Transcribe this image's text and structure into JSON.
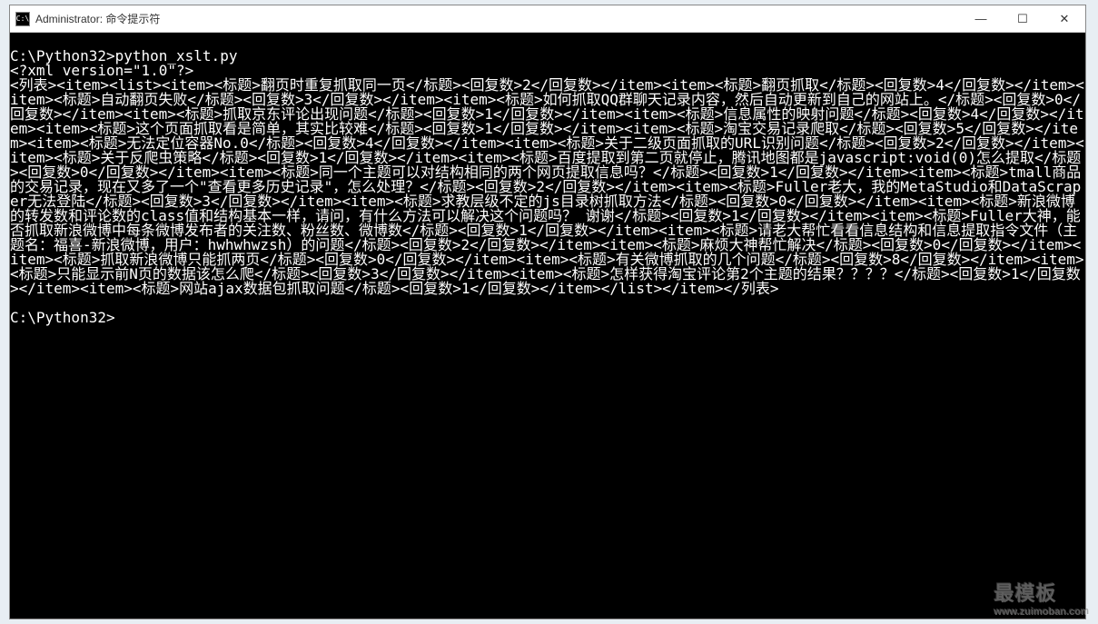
{
  "titlebar": {
    "icon_label": "C:\\",
    "title": "Administrator: 命令提示符",
    "minimize": "—",
    "maximize": "☐",
    "close": "✕"
  },
  "console": {
    "blank": "",
    "prompt_cmd": "C:\\Python32>python_xslt.py",
    "xml_decl": "<?xml version=\"1.0\"?>",
    "prompt_end": "C:\\Python32>"
  },
  "xml_root": "列表",
  "items": [
    {
      "title": "翻页时重复抓取同一页",
      "reply": "2"
    },
    {
      "title": "翻页抓取",
      "reply": "4"
    },
    {
      "title": "自动翻页失败",
      "reply": "3"
    },
    {
      "title": "如何抓取QQ群聊天记录内容，然后自动更新到自己的网站上。",
      "reply": "0"
    },
    {
      "title": "抓取京东评论出现问题",
      "reply": "1"
    },
    {
      "title": "信息属性的映射问题",
      "reply": "4"
    },
    {
      "title": "这个页面抓取看是简单，其实比较难",
      "reply": "1"
    },
    {
      "title": "淘宝交易记录爬取",
      "reply": "5"
    },
    {
      "title": "无法定位容器No.0",
      "reply": "4"
    },
    {
      "title": "关于二级页面抓取的URL识别问题",
      "reply": "2"
    },
    {
      "title": "关于反爬虫策略",
      "reply": "1"
    },
    {
      "title": "百度提取到第二页就停止，腾讯地图都是javascript:void(0)怎么提取",
      "reply": "0"
    },
    {
      "title": "同一个主题可以对结构相同的两个网页提取信息吗？",
      "reply": "1"
    },
    {
      "title": "tmall商品的交易记录，现在又多了一个\"查看更多历史记录\"，怎么处理？",
      "reply": "2"
    },
    {
      "title": "Fuller老大，我的MetaStudio和DataScraper无法登陆",
      "reply": "3"
    },
    {
      "title": "求教层级不定的js目录树抓取方法",
      "reply": "0"
    },
    {
      "title": "新浪微博的转发数和评论数的class值和结构基本一样，请问，有什么方法可以解决这个问题吗？ 谢谢",
      "reply": "1"
    },
    {
      "title": "Fuller大神，能否抓取新浪微博中每条微博发布者的关注数、粉丝数、微博数",
      "reply": "1"
    },
    {
      "title": "请老大帮忙看看信息结构和信息提取指令文件（主题名：福喜-新浪微博，用户：hwhwhwzsh）的问题",
      "reply": "2"
    },
    {
      "title": "麻烦大神帮忙解决",
      "reply": "0"
    },
    {
      "title": "抓取新浪微博只能抓两页",
      "reply": "0"
    },
    {
      "title": "有关微博抓取的几个问题",
      "reply": "8"
    },
    {
      "title": "只能显示前N页的数据该怎么爬",
      "reply": "3"
    },
    {
      "title": "怎样获得淘宝评论第2个主题的结果？？？？",
      "reply": "1"
    },
    {
      "title": "网站ajax数据包抓取问题",
      "reply": "1"
    }
  ],
  "watermark": {
    "main": "最模板",
    "sub": "www.zuimoban.com"
  }
}
